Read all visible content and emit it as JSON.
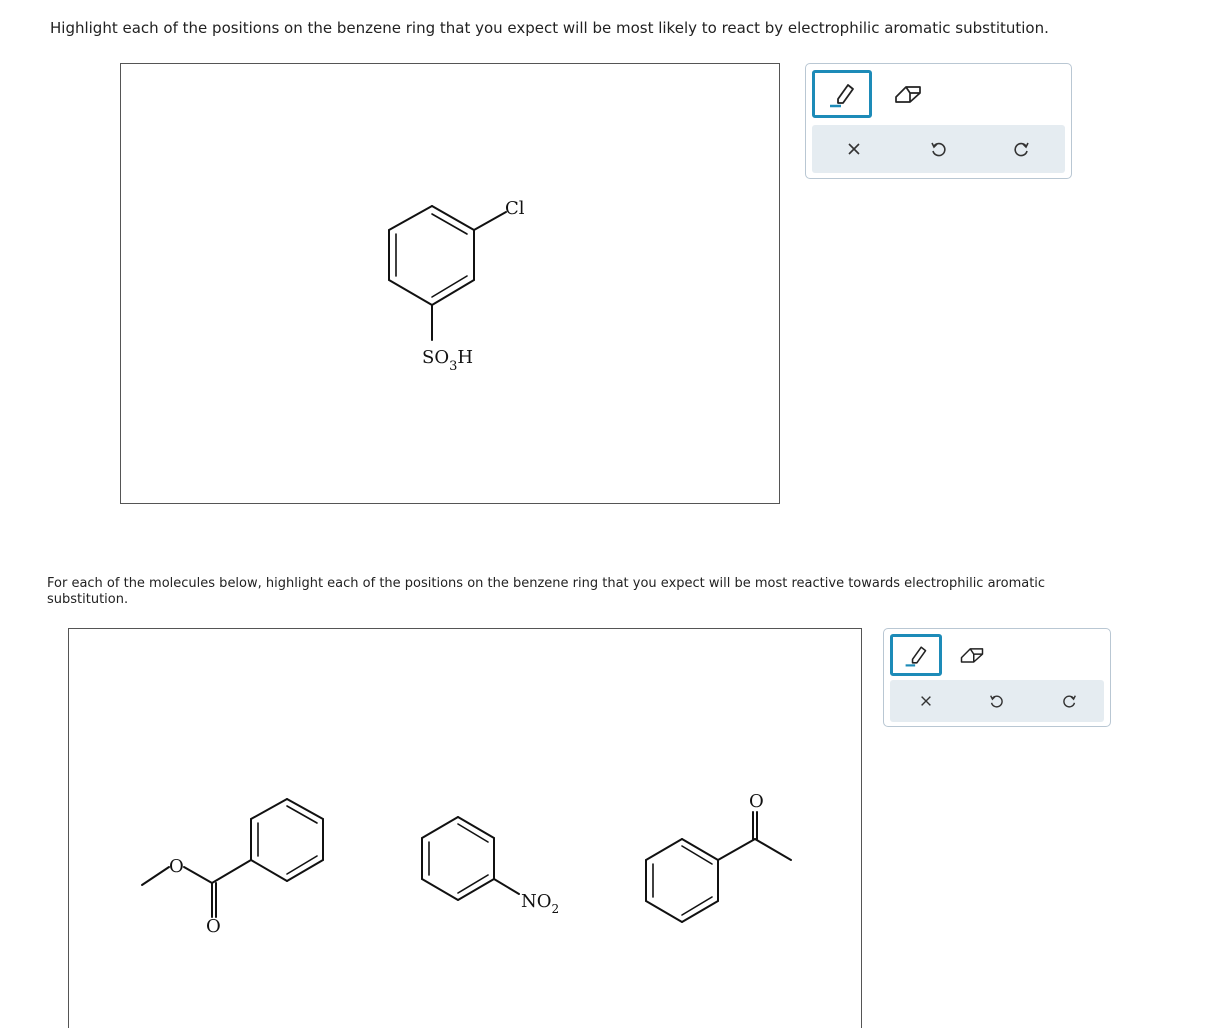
{
  "question1": {
    "instruction": "Highlight each of the positions on the benzene ring that you expect will be most likely to react by electrophilic aromatic substitution.",
    "molecule": {
      "substituent_top": "Cl",
      "substituent_bottom_main": "SO",
      "substituent_bottom_sub": "3",
      "substituent_bottom_tail": "H"
    }
  },
  "question2": {
    "instruction": "For each of the molecules below, highlight each of the positions on the benzene ring that you expect will be most reactive towards electrophilic aromatic substitution.",
    "molecules": {
      "ester_ether_o": "O",
      "ester_carbonyl_o": "O",
      "nitro_main": "NO",
      "nitro_sub": "2",
      "ketone_o": "O"
    }
  },
  "toolbar": {
    "tools": [
      "highlighter-icon",
      "eraser-icon"
    ],
    "actions": [
      "clear-icon",
      "undo-icon",
      "redo-icon"
    ],
    "accent_color": "#1d8bb8",
    "action_bg": "#e5ecf1"
  }
}
